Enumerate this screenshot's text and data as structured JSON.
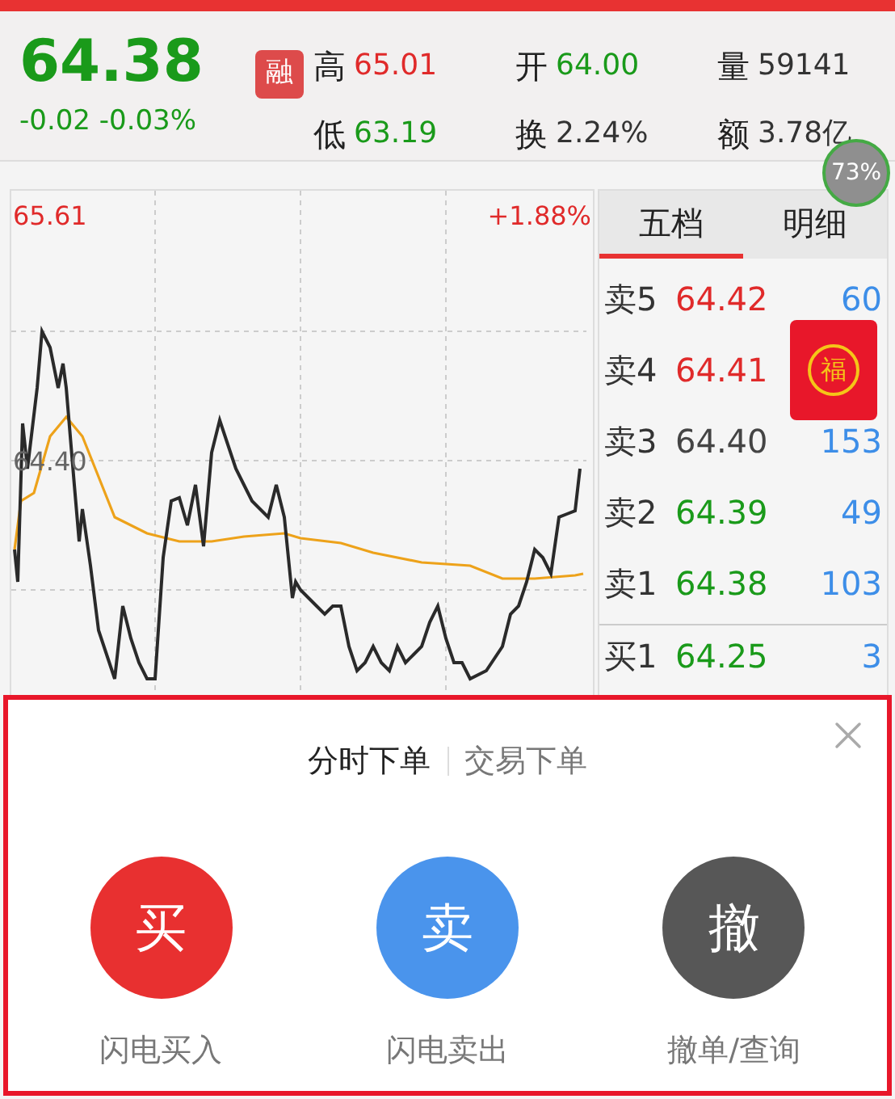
{
  "quote": {
    "price": "64.38",
    "change": "-0.02 -0.03%",
    "badge": "融",
    "stats": [
      {
        "label": "高",
        "value": "65.01",
        "color": "#e02a2a"
      },
      {
        "label": "开",
        "value": "64.00",
        "color": "#1a9a1a"
      },
      {
        "label": "量",
        "value": "59141",
        "color": "#333333"
      },
      {
        "label": "低",
        "value": "63.19",
        "color": "#1a9a1a"
      },
      {
        "label": "换",
        "value": "2.24%",
        "color": "#333333"
      },
      {
        "label": "额",
        "value": "3.78亿",
        "color": "#333333"
      }
    ]
  },
  "chart": {
    "high_label": "65.61",
    "high_pct": "+1.88%",
    "mid_label": "64.40"
  },
  "usage_badge": "73%",
  "order_book": {
    "tabs": [
      {
        "label": "五档",
        "selected": true
      },
      {
        "label": "明细",
        "selected": false
      }
    ],
    "asks": [
      {
        "label": "卖5",
        "price": "64.42",
        "volume": "60",
        "color": "#e02a2a"
      },
      {
        "label": "卖4",
        "price": "64.41",
        "color": "#e02a2a"
      },
      {
        "label": "卖3",
        "price": "64.40",
        "volume": "153",
        "color": "#444444"
      },
      {
        "label": "卖2",
        "price": "64.39",
        "volume": "49",
        "color": "#1a9a1a"
      },
      {
        "label": "卖1",
        "price": "64.38",
        "volume": "103",
        "color": "#1a9a1a"
      }
    ],
    "bids": [
      {
        "label": "买1",
        "price": "64.25",
        "volume": "3",
        "color": "#1a9a1a"
      }
    ]
  },
  "red_envelope": {
    "glyph": "福"
  },
  "trade_sheet": {
    "tabs": [
      {
        "label": "分时下单",
        "selected": true
      },
      {
        "label": "交易下单",
        "selected": false
      }
    ],
    "actions": [
      {
        "kind": "buy",
        "glyph": "买",
        "label": "闪电买入"
      },
      {
        "kind": "sell",
        "glyph": "卖",
        "label": "闪电卖出"
      },
      {
        "kind": "cancel",
        "glyph": "撤",
        "label": "撤单/查询"
      }
    ]
  }
}
